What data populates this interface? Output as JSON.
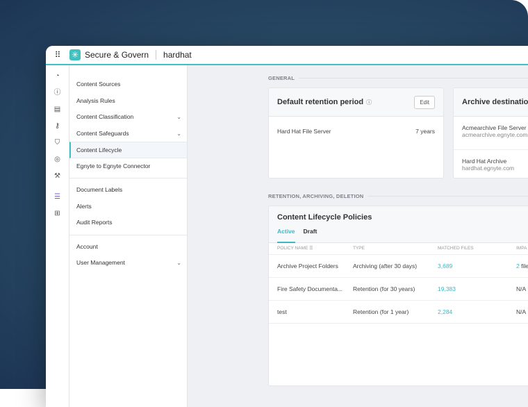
{
  "header": {
    "app_title": "Secure & Govern",
    "org": "hardhat"
  },
  "nav": {
    "group1": [
      {
        "label": "Content Sources"
      },
      {
        "label": "Analysis Rules"
      },
      {
        "label": "Content Classification",
        "chevron": true
      },
      {
        "label": "Content Safeguards",
        "chevron": true
      },
      {
        "label": "Content Lifecycle",
        "active": true
      },
      {
        "label": "Egnyte to Egnyte Connector"
      }
    ],
    "group2": [
      {
        "label": "Document Labels"
      },
      {
        "label": "Alerts"
      },
      {
        "label": "Audit Reports"
      }
    ],
    "group3": [
      {
        "label": "Account"
      },
      {
        "label": "User Management",
        "chevron": true
      }
    ]
  },
  "general": {
    "section": "GENERAL",
    "retention": {
      "title": "Default retention period",
      "edit": "Edit",
      "server": "Hard Hat File Server",
      "period": "7 years"
    },
    "archive": {
      "title": "Archive destination",
      "items": [
        {
          "name": "Acmearchive File Server",
          "host": "acmearchive.egnyte.com"
        },
        {
          "name": "Hard Hat Archive",
          "host": "hardhat.egnyte.com"
        }
      ]
    }
  },
  "policies": {
    "section": "RETENTION, ARCHIVING, DELETION",
    "title": "Content Lifecycle Policies",
    "tabs": [
      "Active",
      "Draft"
    ],
    "columns": [
      "POLICY NAME",
      "TYPE",
      "MATCHED FILES",
      "IMPA"
    ],
    "rows": [
      {
        "name": "Archive Project Folders",
        "type": "Archiving (after 30 days)",
        "matched": "3,689",
        "impact": "2",
        "impact_suffix": "file"
      },
      {
        "name": "Fire Safety Documenta...",
        "type": "Retention (for 30 years)",
        "matched": "19,383",
        "impact": "N/A"
      },
      {
        "name": "test",
        "type": "Retention (for 1 year)",
        "matched": "2,284",
        "impact": "N/A"
      }
    ]
  }
}
